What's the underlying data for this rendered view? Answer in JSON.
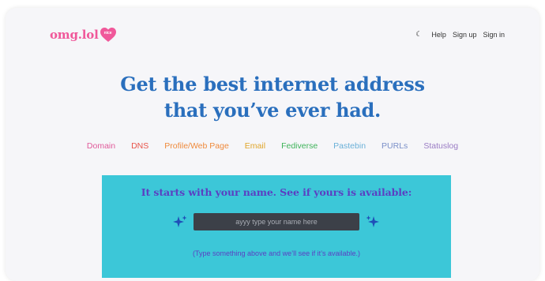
{
  "logo": {
    "text": "omg.lol",
    "badge_text": "nice",
    "brand_color": "#f0589a"
  },
  "nav": {
    "theme_icon": "moon-icon",
    "items": [
      {
        "label": "Help"
      },
      {
        "label": "Sign up"
      },
      {
        "label": "Sign in"
      }
    ]
  },
  "hero": {
    "line1": "Get the best internet address",
    "line2": "that you’ve ever had.",
    "color": "#2a6fbd"
  },
  "services": [
    {
      "label": "Domain",
      "color": "#e05a9a"
    },
    {
      "label": "DNS",
      "color": "#e8544a"
    },
    {
      "label": "Profile/Web Page",
      "color": "#ef8a3c"
    },
    {
      "label": "Email",
      "color": "#e0a52a"
    },
    {
      "label": "Fediverse",
      "color": "#3fb35a"
    },
    {
      "label": "Pastebin",
      "color": "#6ab0d8"
    },
    {
      "label": "PURLs",
      "color": "#7a8fc8"
    },
    {
      "label": "Statuslog",
      "color": "#9a7cc4"
    }
  ],
  "availability": {
    "title": "It starts with your name. See if yours is available:",
    "input_placeholder": "ayyy type your name here",
    "input_value": "",
    "hint": "(Type something above and we’ll see if it’s available.)",
    "panel_color": "#3cc7d8",
    "text_color": "#5b3fc2",
    "left_icon": "sparkles-icon",
    "right_icon": "sparkles-icon"
  }
}
